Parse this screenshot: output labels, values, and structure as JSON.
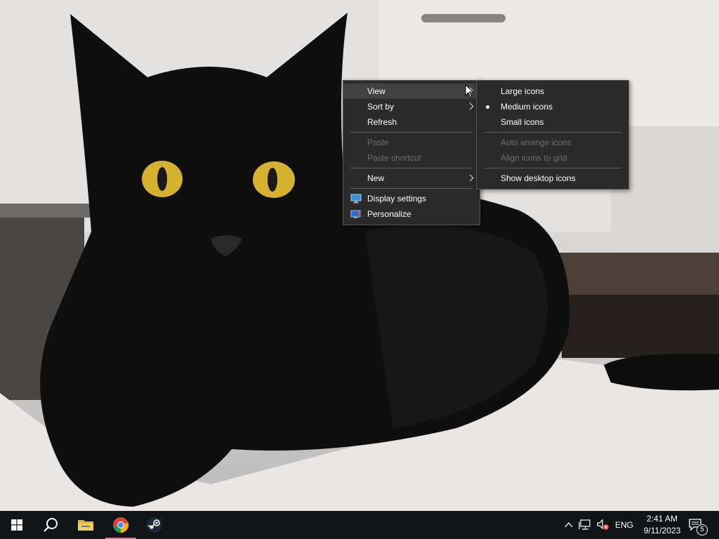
{
  "desktop": {
    "wallpaper": "black-cat-photo"
  },
  "context_menu": {
    "items": [
      {
        "label": "View",
        "has_submenu": true,
        "highlighted": true
      },
      {
        "label": "Sort by",
        "has_submenu": true
      },
      {
        "label": "Refresh"
      },
      {
        "label": "Paste",
        "disabled": true
      },
      {
        "label": "Paste shortcut",
        "disabled": true
      },
      {
        "label": "New",
        "has_submenu": true
      },
      {
        "label": "Display settings",
        "icon": "display-settings-icon"
      },
      {
        "label": "Personalize",
        "icon": "personalize-icon"
      }
    ]
  },
  "view_submenu": {
    "items": [
      {
        "label": "Large icons"
      },
      {
        "label": "Medium icons",
        "selected": true
      },
      {
        "label": "Small icons"
      },
      {
        "label": "Auto arrange icons",
        "disabled": true
      },
      {
        "label": "Align icons to grid",
        "disabled": true
      },
      {
        "label": "Show desktop icons"
      }
    ]
  },
  "taskbar": {
    "apps": [
      {
        "name": "start",
        "icon": "windows-logo-icon"
      },
      {
        "name": "search",
        "icon": "search-icon"
      },
      {
        "name": "file-explorer",
        "icon": "folder-icon"
      },
      {
        "name": "chrome",
        "icon": "chrome-icon",
        "running": true
      },
      {
        "name": "steam",
        "icon": "steam-icon"
      }
    ],
    "tray": {
      "language": "ENG",
      "time": "2:41 AM",
      "date": "9/11/2023",
      "notification_count": "5"
    }
  },
  "colors": {
    "menu_bg": "#2b2b2b",
    "menu_highlight": "#414141",
    "taskbar_bg": "#101417",
    "disabled_text": "#6f6f6f"
  }
}
